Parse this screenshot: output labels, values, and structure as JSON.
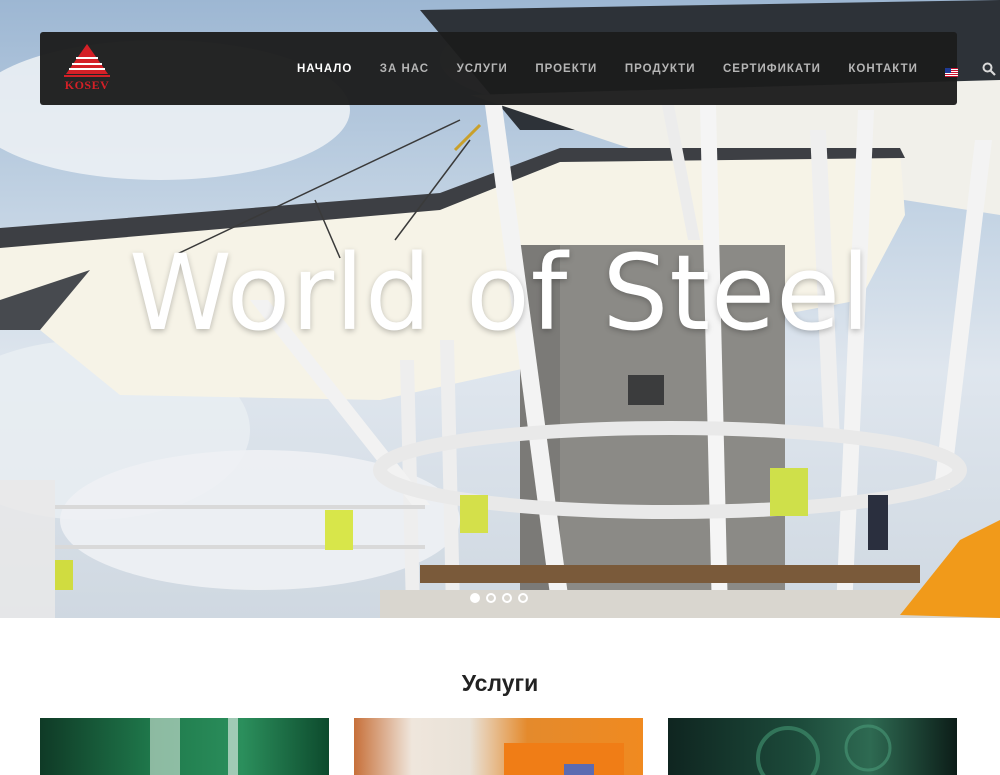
{
  "brand": {
    "logo_text": "KOSEV",
    "colors": {
      "accent": "#d42027",
      "navbar": "#1c1c1c",
      "active_link": "#ffffff",
      "inactive_link": "#b5b5b5"
    }
  },
  "nav": {
    "items": [
      {
        "label": "НАЧАЛО",
        "active": true
      },
      {
        "label": "ЗА НАС",
        "active": false
      },
      {
        "label": "УСЛУГИ",
        "active": false
      },
      {
        "label": "ПРОЕКТИ",
        "active": false
      },
      {
        "label": "ПРОДУКТИ",
        "active": false
      },
      {
        "label": "СЕРТИФИКАТИ",
        "active": false
      },
      {
        "label": "КОНТАКТИ",
        "active": false
      }
    ],
    "language_icon": "us-flag-icon",
    "search_icon": "search-icon"
  },
  "hero": {
    "title": "World of Steel",
    "slides_total": 4,
    "active_slide": 1
  },
  "services": {
    "heading": "Услуги",
    "cards": [
      {
        "name": "service-card-1"
      },
      {
        "name": "service-card-2"
      },
      {
        "name": "service-card-3"
      }
    ]
  }
}
